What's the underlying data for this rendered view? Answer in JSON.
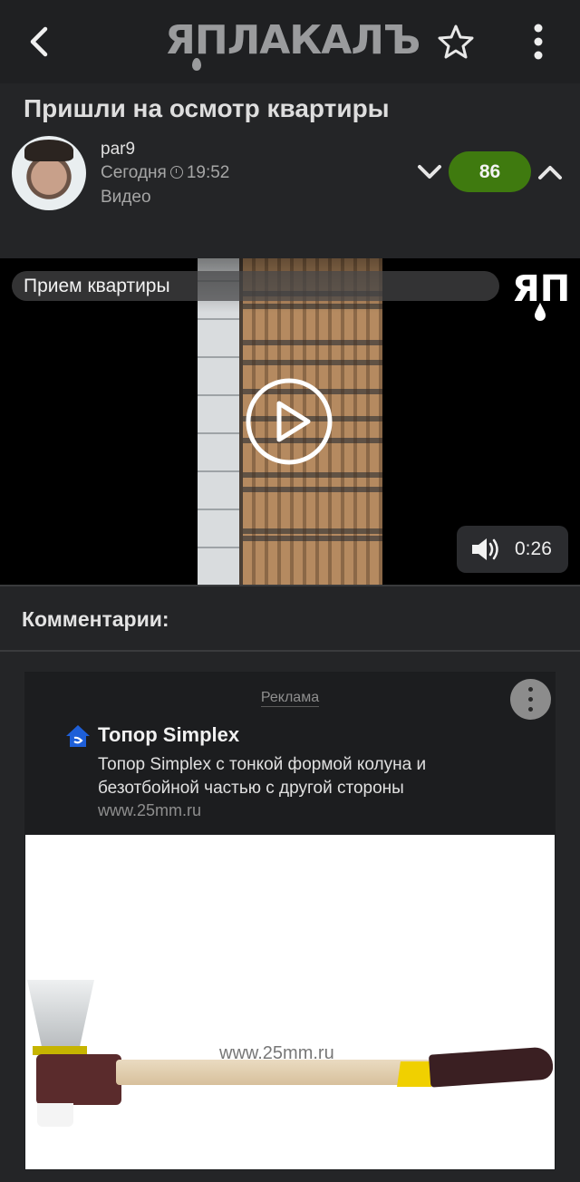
{
  "app": {
    "logo_text": "ЯПЛАКАЛЪ"
  },
  "post": {
    "title": "Пришли на осмотр квартиры",
    "author": "par9",
    "date_label": "Сегодня",
    "time": "19:52",
    "type": "Видео",
    "rating": "86"
  },
  "video": {
    "title": "Прием квартиры",
    "duration": "0:26",
    "logo_text": "ЯП"
  },
  "comments": {
    "header": "Комментарии:"
  },
  "ad": {
    "label": "Реклама",
    "title": "Топор Simplex",
    "description": "Топор Simplex с тонкой формой колуна и безотбойной частью с другой стороны",
    "url": "www.25mm.ru",
    "image_watermark": "www.25mm.ru"
  },
  "colors": {
    "background": "#242527",
    "topbar": "#1f2022",
    "rating_bg": "#3f7a0f",
    "ad_bg": "#1c1d1f"
  },
  "icons": [
    "back-arrow-icon",
    "star-icon",
    "more-vertical-icon",
    "clock-icon",
    "chevron-down-icon",
    "chevron-up-icon",
    "play-icon",
    "volume-icon",
    "ad-brand-icon"
  ]
}
